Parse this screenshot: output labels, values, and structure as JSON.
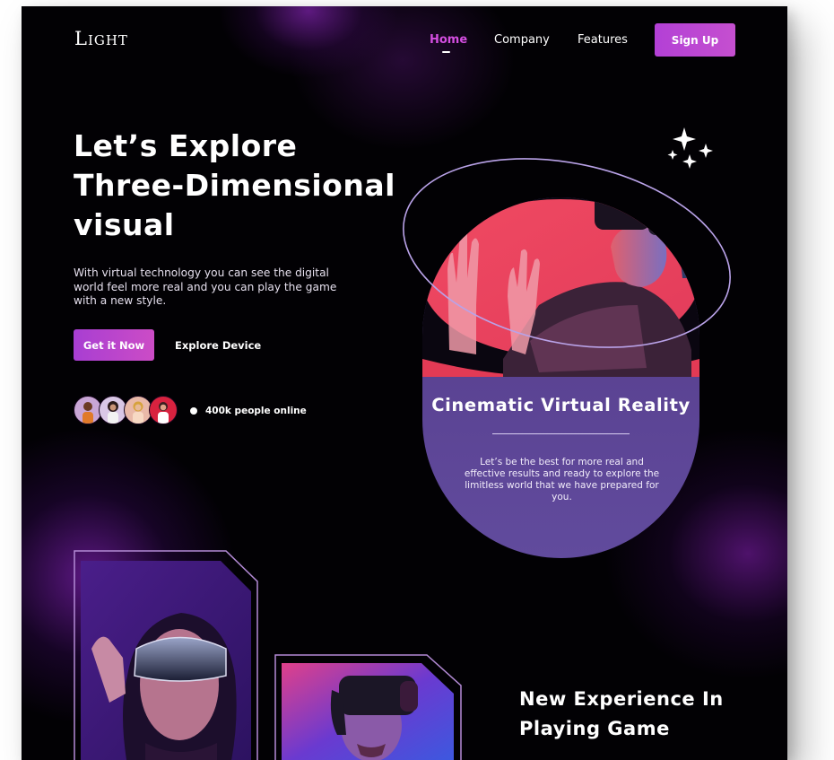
{
  "brand": {
    "logo_text": "Light"
  },
  "nav": {
    "items": [
      {
        "label": "Home",
        "active": true
      },
      {
        "label": "Company",
        "active": false
      },
      {
        "label": "Features",
        "active": false
      }
    ],
    "signup_label": "Sign Up"
  },
  "hero": {
    "title_line1": "Let’s Explore",
    "title_line2": "Three-Dimensional",
    "title_line3": "visual",
    "description": "With virtual technology you can see the digital world feel more real and you can play the game with a new style.",
    "primary_button": "Get it Now",
    "secondary_button": "Explore Device",
    "online_text": "400k people online"
  },
  "feature_card": {
    "title": "Cinematic Virtual Reality",
    "text": "Let’s be the best for more real and effective results and ready to explore the limitless world that we have prepared for you."
  },
  "section2": {
    "title_line1": "New Experience In",
    "title_line2": "Playing Game"
  },
  "colors": {
    "accent": "#c048d8",
    "nav_active": "#d44ee0",
    "card": "#5e4390",
    "background": "#020104"
  }
}
